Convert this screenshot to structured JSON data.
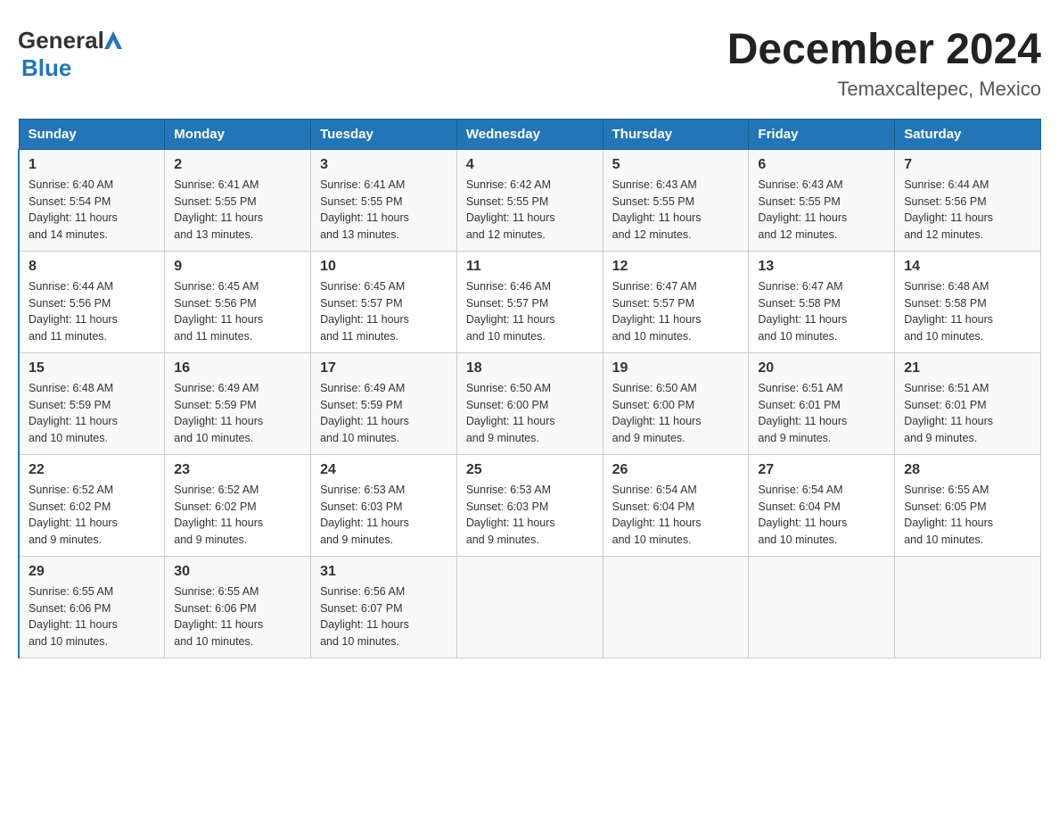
{
  "header": {
    "logo_general": "General",
    "logo_blue": "Blue",
    "month_title": "December 2024",
    "location": "Temaxcaltepec, Mexico"
  },
  "weekdays": [
    "Sunday",
    "Monday",
    "Tuesday",
    "Wednesday",
    "Thursday",
    "Friday",
    "Saturday"
  ],
  "weeks": [
    [
      {
        "day": "1",
        "sunrise": "6:40 AM",
        "sunset": "5:54 PM",
        "daylight": "11 hours and 14 minutes."
      },
      {
        "day": "2",
        "sunrise": "6:41 AM",
        "sunset": "5:55 PM",
        "daylight": "11 hours and 13 minutes."
      },
      {
        "day": "3",
        "sunrise": "6:41 AM",
        "sunset": "5:55 PM",
        "daylight": "11 hours and 13 minutes."
      },
      {
        "day": "4",
        "sunrise": "6:42 AM",
        "sunset": "5:55 PM",
        "daylight": "11 hours and 12 minutes."
      },
      {
        "day": "5",
        "sunrise": "6:43 AM",
        "sunset": "5:55 PM",
        "daylight": "11 hours and 12 minutes."
      },
      {
        "day": "6",
        "sunrise": "6:43 AM",
        "sunset": "5:55 PM",
        "daylight": "11 hours and 12 minutes."
      },
      {
        "day": "7",
        "sunrise": "6:44 AM",
        "sunset": "5:56 PM",
        "daylight": "11 hours and 12 minutes."
      }
    ],
    [
      {
        "day": "8",
        "sunrise": "6:44 AM",
        "sunset": "5:56 PM",
        "daylight": "11 hours and 11 minutes."
      },
      {
        "day": "9",
        "sunrise": "6:45 AM",
        "sunset": "5:56 PM",
        "daylight": "11 hours and 11 minutes."
      },
      {
        "day": "10",
        "sunrise": "6:45 AM",
        "sunset": "5:57 PM",
        "daylight": "11 hours and 11 minutes."
      },
      {
        "day": "11",
        "sunrise": "6:46 AM",
        "sunset": "5:57 PM",
        "daylight": "11 hours and 10 minutes."
      },
      {
        "day": "12",
        "sunrise": "6:47 AM",
        "sunset": "5:57 PM",
        "daylight": "11 hours and 10 minutes."
      },
      {
        "day": "13",
        "sunrise": "6:47 AM",
        "sunset": "5:58 PM",
        "daylight": "11 hours and 10 minutes."
      },
      {
        "day": "14",
        "sunrise": "6:48 AM",
        "sunset": "5:58 PM",
        "daylight": "11 hours and 10 minutes."
      }
    ],
    [
      {
        "day": "15",
        "sunrise": "6:48 AM",
        "sunset": "5:59 PM",
        "daylight": "11 hours and 10 minutes."
      },
      {
        "day": "16",
        "sunrise": "6:49 AM",
        "sunset": "5:59 PM",
        "daylight": "11 hours and 10 minutes."
      },
      {
        "day": "17",
        "sunrise": "6:49 AM",
        "sunset": "5:59 PM",
        "daylight": "11 hours and 10 minutes."
      },
      {
        "day": "18",
        "sunrise": "6:50 AM",
        "sunset": "6:00 PM",
        "daylight": "11 hours and 9 minutes."
      },
      {
        "day": "19",
        "sunrise": "6:50 AM",
        "sunset": "6:00 PM",
        "daylight": "11 hours and 9 minutes."
      },
      {
        "day": "20",
        "sunrise": "6:51 AM",
        "sunset": "6:01 PM",
        "daylight": "11 hours and 9 minutes."
      },
      {
        "day": "21",
        "sunrise": "6:51 AM",
        "sunset": "6:01 PM",
        "daylight": "11 hours and 9 minutes."
      }
    ],
    [
      {
        "day": "22",
        "sunrise": "6:52 AM",
        "sunset": "6:02 PM",
        "daylight": "11 hours and 9 minutes."
      },
      {
        "day": "23",
        "sunrise": "6:52 AM",
        "sunset": "6:02 PM",
        "daylight": "11 hours and 9 minutes."
      },
      {
        "day": "24",
        "sunrise": "6:53 AM",
        "sunset": "6:03 PM",
        "daylight": "11 hours and 9 minutes."
      },
      {
        "day": "25",
        "sunrise": "6:53 AM",
        "sunset": "6:03 PM",
        "daylight": "11 hours and 9 minutes."
      },
      {
        "day": "26",
        "sunrise": "6:54 AM",
        "sunset": "6:04 PM",
        "daylight": "11 hours and 10 minutes."
      },
      {
        "day": "27",
        "sunrise": "6:54 AM",
        "sunset": "6:04 PM",
        "daylight": "11 hours and 10 minutes."
      },
      {
        "day": "28",
        "sunrise": "6:55 AM",
        "sunset": "6:05 PM",
        "daylight": "11 hours and 10 minutes."
      }
    ],
    [
      {
        "day": "29",
        "sunrise": "6:55 AM",
        "sunset": "6:06 PM",
        "daylight": "11 hours and 10 minutes."
      },
      {
        "day": "30",
        "sunrise": "6:55 AM",
        "sunset": "6:06 PM",
        "daylight": "11 hours and 10 minutes."
      },
      {
        "day": "31",
        "sunrise": "6:56 AM",
        "sunset": "6:07 PM",
        "daylight": "11 hours and 10 minutes."
      },
      null,
      null,
      null,
      null
    ]
  ],
  "labels": {
    "sunrise_prefix": "Sunrise: ",
    "sunset_prefix": "Sunset: ",
    "daylight_prefix": "Daylight: "
  }
}
